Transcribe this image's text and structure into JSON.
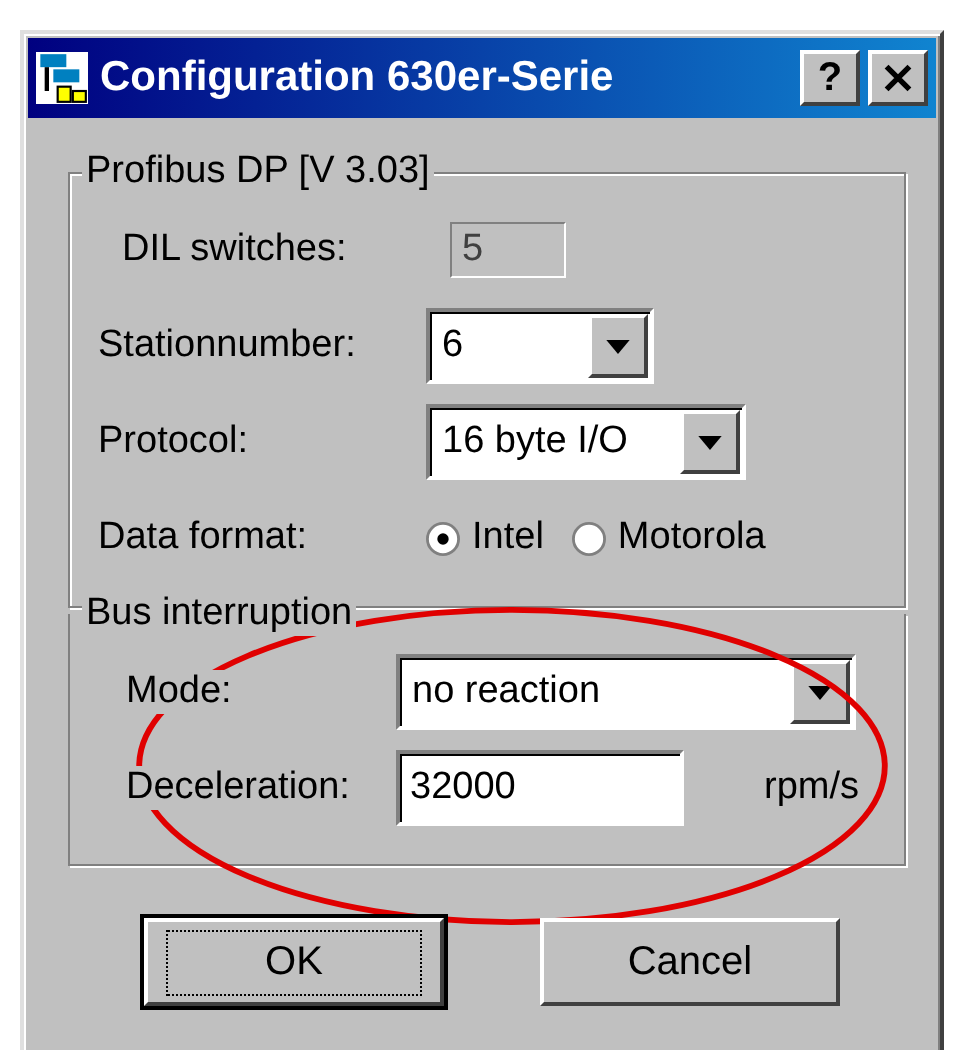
{
  "window": {
    "title": "Configuration 630er-Serie",
    "help_button": "?"
  },
  "groups": [
    {
      "title": "Profibus DP [V 3.03]",
      "fields": [
        {
          "kind": "readonly",
          "label": "DIL switches:",
          "value": "5"
        },
        {
          "kind": "combo",
          "label": "Stationnumber:",
          "value": "6"
        },
        {
          "kind": "combo",
          "label": "Protocol:",
          "value": "16 byte I/O"
        },
        {
          "kind": "radio",
          "label": "Data format:",
          "options": [
            {
              "label": "Intel",
              "selected": true
            },
            {
              "label": "Motorola",
              "selected": false
            }
          ]
        }
      ]
    },
    {
      "title": "Bus interruption",
      "fields": [
        {
          "kind": "combo",
          "label": "Mode:",
          "value": "no reaction"
        },
        {
          "kind": "text",
          "label": "Deceleration:",
          "value": "32000",
          "unit": "rpm/s"
        }
      ]
    }
  ],
  "buttons": [
    {
      "label": "OK",
      "default": true
    },
    {
      "label": "Cancel",
      "default": false
    }
  ]
}
